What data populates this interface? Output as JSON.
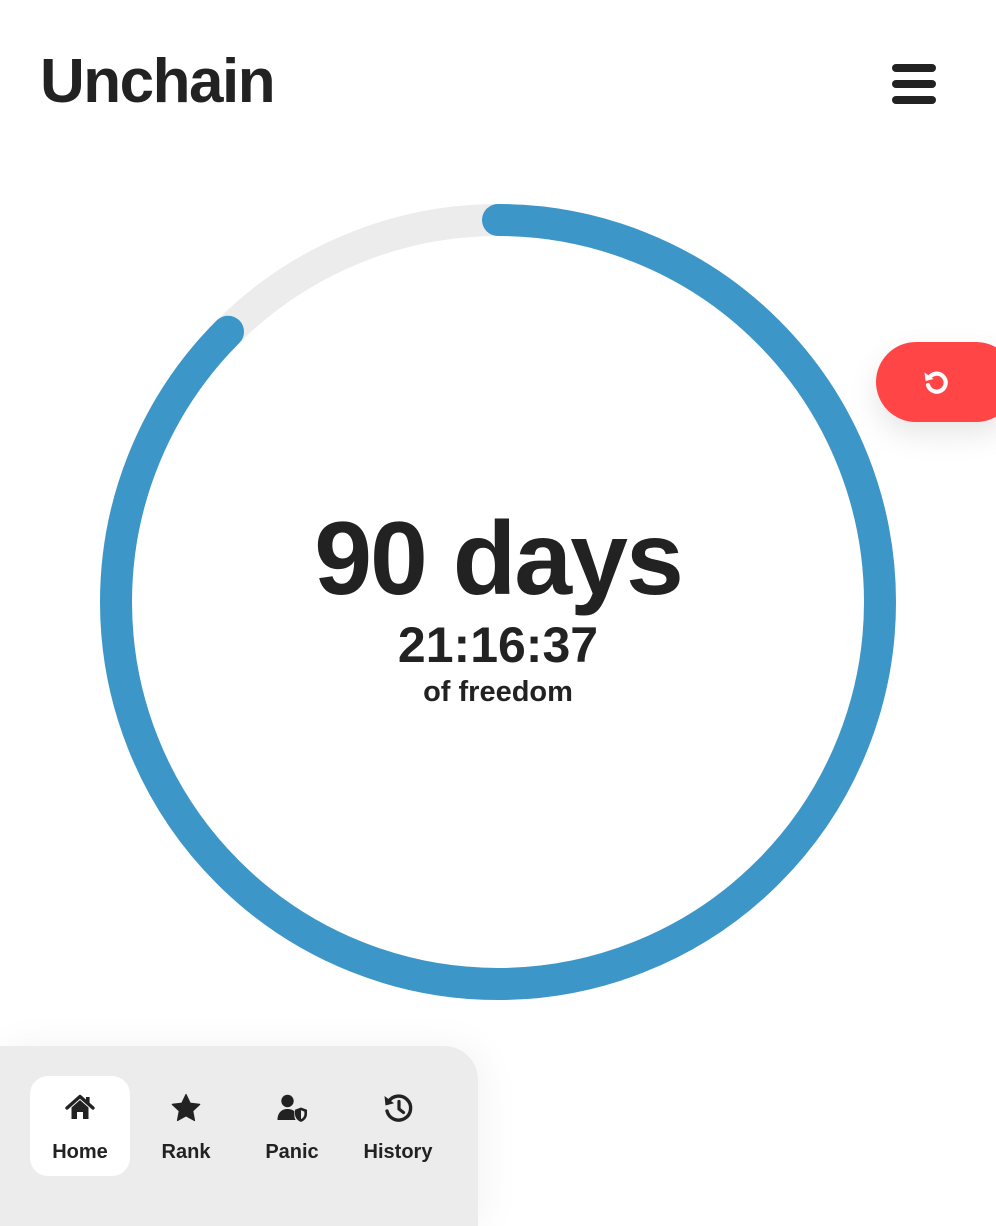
{
  "header": {
    "title": "Unchain",
    "menu_icon": "hamburger-menu-icon"
  },
  "counter": {
    "days": "90 days",
    "time": "21:16:37",
    "caption": "of freedom",
    "ring_progress_fraction": 0.875,
    "ring_color": "#3d96c8",
    "ring_track_color": "#ececec"
  },
  "reset_button": {
    "icon": "reset-icon",
    "color": "#ff4545"
  },
  "nav": {
    "items": [
      {
        "label": "Home",
        "icon": "home-icon",
        "active": true
      },
      {
        "label": "Rank",
        "icon": "star-icon",
        "active": false
      },
      {
        "label": "Panic",
        "icon": "user-shield-icon",
        "active": false
      },
      {
        "label": "History",
        "icon": "history-icon",
        "active": false
      }
    ]
  }
}
